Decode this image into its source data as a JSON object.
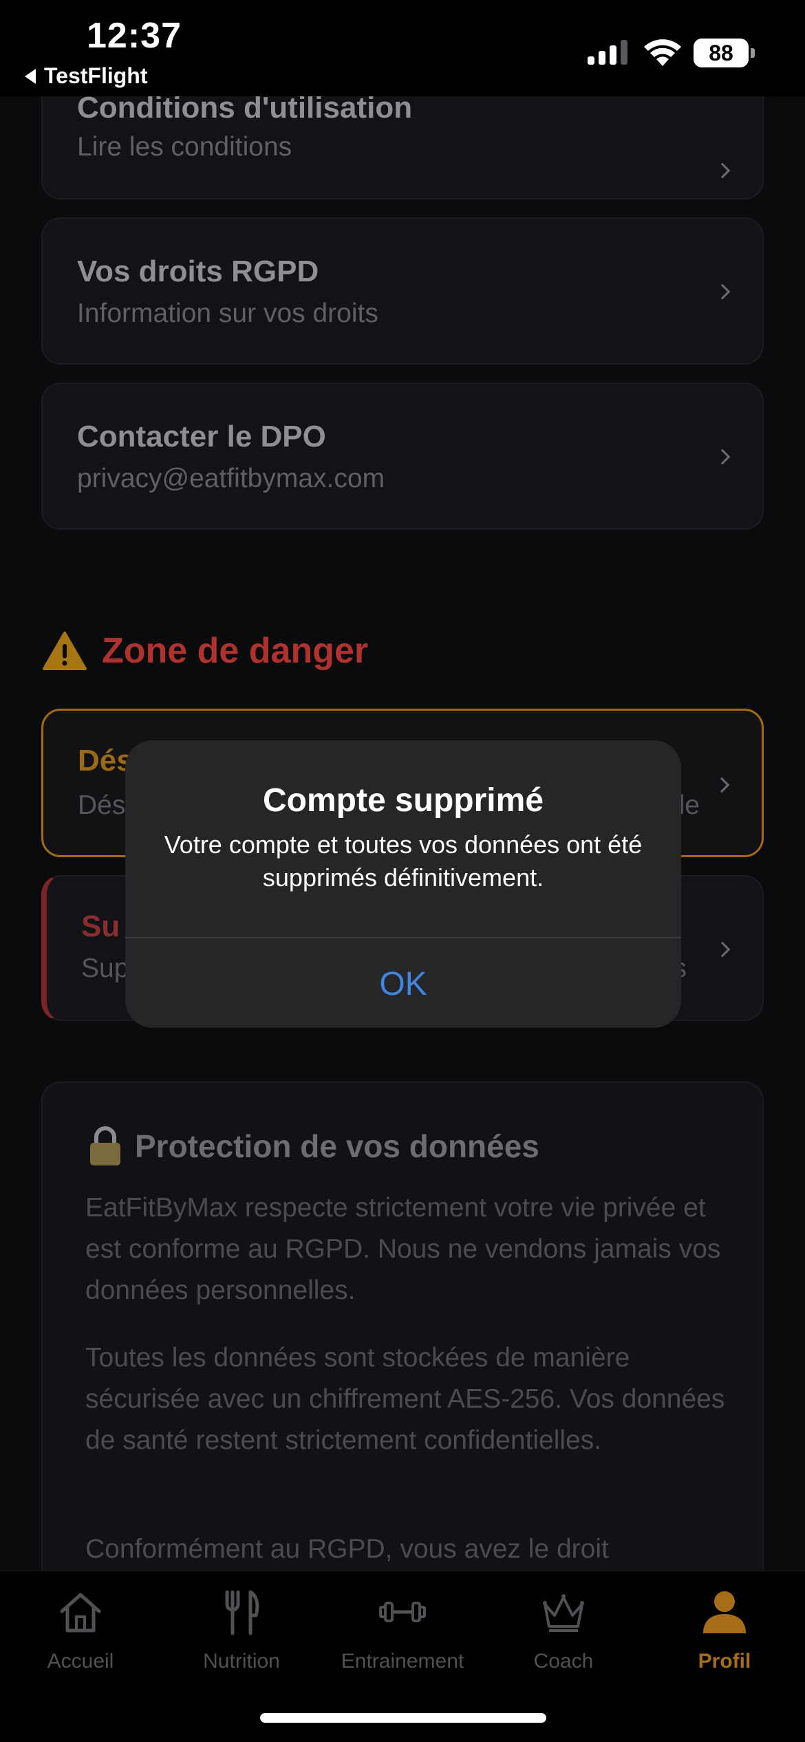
{
  "status": {
    "time": "12:37",
    "back_app": "TestFlight",
    "battery": "88"
  },
  "legal_links": [
    {
      "title": "Conditions d'utilisation",
      "subtitle": "Lire les conditions"
    },
    {
      "title": "Vos droits RGPD",
      "subtitle": "Information sur vos droits"
    },
    {
      "title": "Contacter le DPO",
      "subtitle": "privacy@eatfitbymax.com"
    }
  ],
  "danger": {
    "title": "Zone de danger",
    "card1_title": "Dés",
    "card1_sub": "Dés",
    "card1_sub_right": "le",
    "card2_title": "Su",
    "card2_sub": "Sup",
    "card2_sub_right": "s"
  },
  "dialog": {
    "title": "Compte supprimé",
    "message": "Votre compte et toutes vos données ont été supprimés définitivement.",
    "ok": "OK"
  },
  "protection": {
    "title": "Protection de vos données",
    "paragraphs": [
      "EatFitByMax respecte strictement votre vie privée et est conforme au RGPD. Nous ne vendons jamais vos données personnelles.",
      "Toutes les données sont stockées de manière sécurisée avec un chiffrement AES-256. Vos données de santé restent strictement confidentielles.",
      "Conformément au RGPD, vous avez le droit"
    ]
  },
  "tabs": [
    {
      "label": "Accueil",
      "icon": "home-icon"
    },
    {
      "label": "Nutrition",
      "icon": "fork-knife-icon"
    },
    {
      "label": "Entrainement",
      "icon": "dumbbell-icon"
    },
    {
      "label": "Coach",
      "icon": "crown-icon"
    },
    {
      "label": "Profil",
      "icon": "person-icon",
      "active": true
    }
  ],
  "colors": {
    "accent": "#a86d18",
    "danger": "#b0322f",
    "link": "#3e86e0"
  }
}
